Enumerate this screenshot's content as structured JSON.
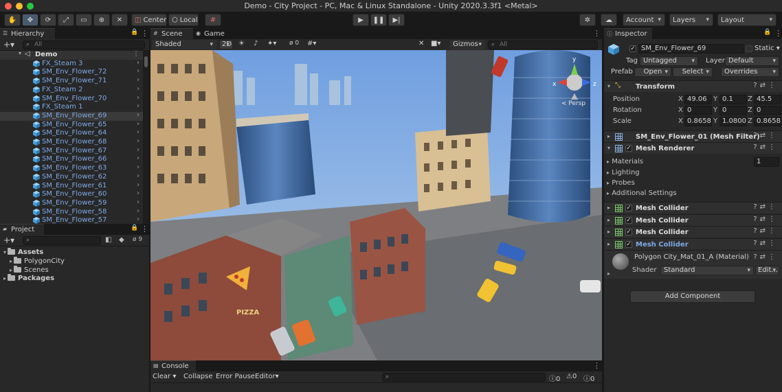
{
  "window": {
    "title": "Demo - City Project - PC, Mac & Linux Standalone - Unity 2020.3.3f1 <Metal>"
  },
  "toolbar": {
    "pivot_label": "Center",
    "space_label": "Local",
    "account_label": "Account",
    "layers_label": "Layers",
    "layout_label": "Layout"
  },
  "hierarchy": {
    "tab_label": "Hierarchy",
    "search_placeholder": "All",
    "root": "Demo",
    "items": [
      {
        "label": "FX_Steam 3",
        "selected": false
      },
      {
        "label": "SM_Env_Flower_72",
        "selected": false
      },
      {
        "label": "SM_Env_Flower_71",
        "selected": false
      },
      {
        "label": "FX_Steam 2",
        "selected": false
      },
      {
        "label": "SM_Env_Flower_70",
        "selected": false
      },
      {
        "label": "FX_Steam 1",
        "selected": false
      },
      {
        "label": "SM_Env_Flower_69",
        "selected": true
      },
      {
        "label": "SM_Env_Flower_65",
        "selected": false
      },
      {
        "label": "SM_Env_Flower_64",
        "selected": false
      },
      {
        "label": "SM_Env_Flower_68",
        "selected": false
      },
      {
        "label": "SM_Env_Flower_67",
        "selected": false
      },
      {
        "label": "SM_Env_Flower_66",
        "selected": false
      },
      {
        "label": "SM_Env_Flower_63",
        "selected": false
      },
      {
        "label": "SM_Env_Flower_62",
        "selected": false
      },
      {
        "label": "SM_Env_Flower_61",
        "selected": false
      },
      {
        "label": "SM_Env_Flower_60",
        "selected": false
      },
      {
        "label": "SM_Env_Flower_59",
        "selected": false
      },
      {
        "label": "SM_Env_Flower_58",
        "selected": false
      },
      {
        "label": "SM_Env_Flower_57",
        "selected": false
      }
    ]
  },
  "project": {
    "tab_label": "Project",
    "hidden_count": "9",
    "assets_label": "Assets",
    "folders": [
      "PolygonCity",
      "Scenes"
    ],
    "packages_label": "Packages"
  },
  "scene": {
    "tab_scene": "Scene",
    "tab_game": "Game",
    "shading_mode": "Shaded",
    "mode_2d": "2D",
    "hidden_count": "0",
    "gizmos_label": "Gizmos",
    "search_placeholder": "All",
    "persp_label": "< Persp",
    "axis_y": "y",
    "axis_x": "x",
    "axis_z": "z",
    "sign_pizza": "PIZZA"
  },
  "console": {
    "tab_label": "Console",
    "clear_label": "Clear",
    "collapse_label": "Collapse",
    "error_pause_label": "Error Pause",
    "editor_label": "Editor",
    "log_count": "0",
    "warn_count": "0",
    "error_count": "0"
  },
  "inspector": {
    "tab_label": "Inspector",
    "object_name": "SM_Env_Flower_69",
    "static_label": "Static",
    "tag_label": "Tag",
    "tag_value": "Untagged",
    "layer_label": "Layer",
    "layer_value": "Default",
    "prefab_label": "Prefab",
    "open_label": "Open",
    "select_label": "Select",
    "overrides_label": "Overrides",
    "transform": {
      "title": "Transform",
      "position_label": "Position",
      "rotation_label": "Rotation",
      "scale_label": "Scale",
      "position": {
        "x": "49.06",
        "y": "0.1",
        "z": "45.5"
      },
      "rotation": {
        "x": "0",
        "y": "0",
        "z": "0"
      },
      "scale": {
        "x": "0.8658",
        "y": "1.0800",
        "z": "0.8658"
      }
    },
    "mesh_filter_title": "SM_Env_Flower_01 (Mesh Filter)",
    "mesh_renderer": {
      "title": "Mesh Renderer",
      "materials_label": "Materials",
      "materials_count": "1",
      "lighting_label": "Lighting",
      "probes_label": "Probes",
      "additional_label": "Additional Settings"
    },
    "colliders": [
      "Mesh Collider",
      "Mesh Collider",
      "Mesh Collider",
      "Mesh Collider"
    ],
    "material_name": "Polygon City_Mat_01_A (Material)",
    "shader_label": "Shader",
    "shader_value": "Standard",
    "edit_label": "Edit...",
    "add_component_label": "Add Component"
  },
  "colors": {
    "accent_blue": "#7fa9e6",
    "mesh_green": "#7bc96a",
    "panel_bg": "#282828"
  }
}
